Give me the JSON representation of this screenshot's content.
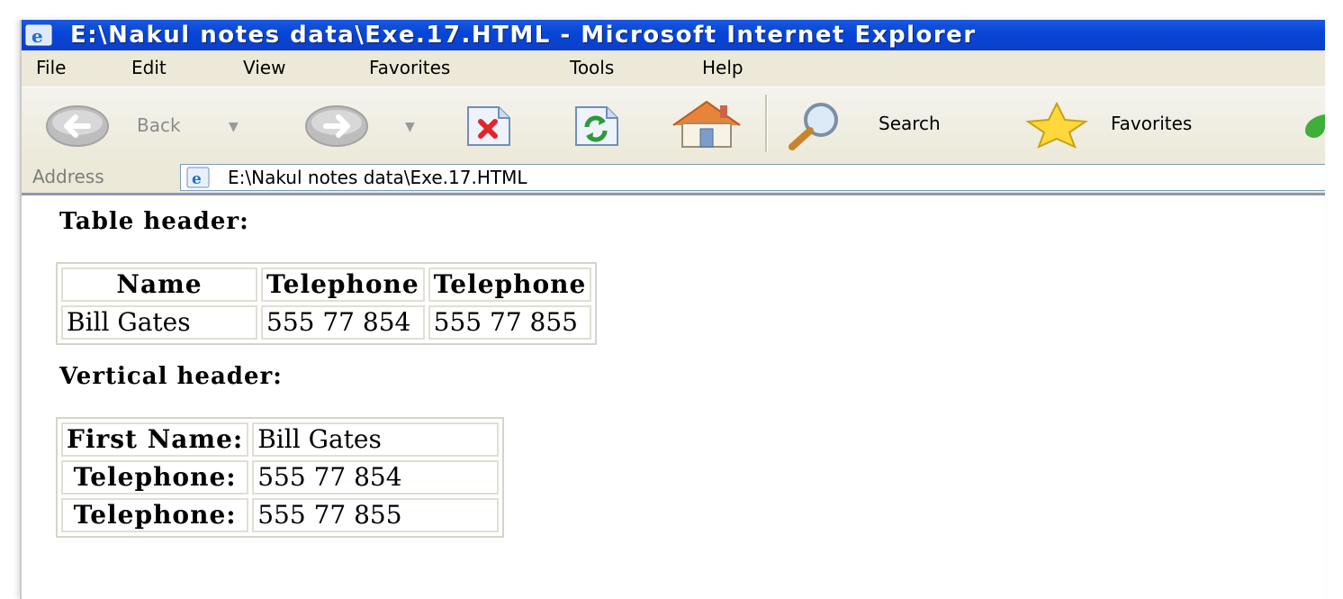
{
  "window": {
    "title": "E:\\Nakul notes data\\Exe.17.HTML - Microsoft Internet Explorer",
    "accent": "#0a46d8"
  },
  "menu": [
    "File",
    "Edit",
    "View",
    "Favorites",
    "Tools",
    "Help"
  ],
  "toolbar": {
    "back_label": "Back",
    "search_label": "Search",
    "favorites_label": "Favorites",
    "icons": [
      "back-icon",
      "forward-icon",
      "stop-icon",
      "refresh-icon",
      "home-icon",
      "search-icon",
      "favorites-icon",
      "media-icon"
    ]
  },
  "address": {
    "label": "Address",
    "value": "E:\\Nakul notes data\\Exe.17.HTML"
  },
  "page": {
    "table_header_title": "Table header:",
    "table1": {
      "headers": [
        "Name",
        "Telephone",
        "Telephone"
      ],
      "row": [
        "Bill Gates",
        "555 77 854",
        "555 77 855"
      ]
    },
    "vertical_header_title": "Vertical header:",
    "table2": {
      "rows": [
        {
          "header": "First Name:",
          "value": "Bill Gates"
        },
        {
          "header": "Telephone:",
          "value": "555 77 854"
        },
        {
          "header": "Telephone:",
          "value": "555 77 855"
        }
      ]
    }
  }
}
